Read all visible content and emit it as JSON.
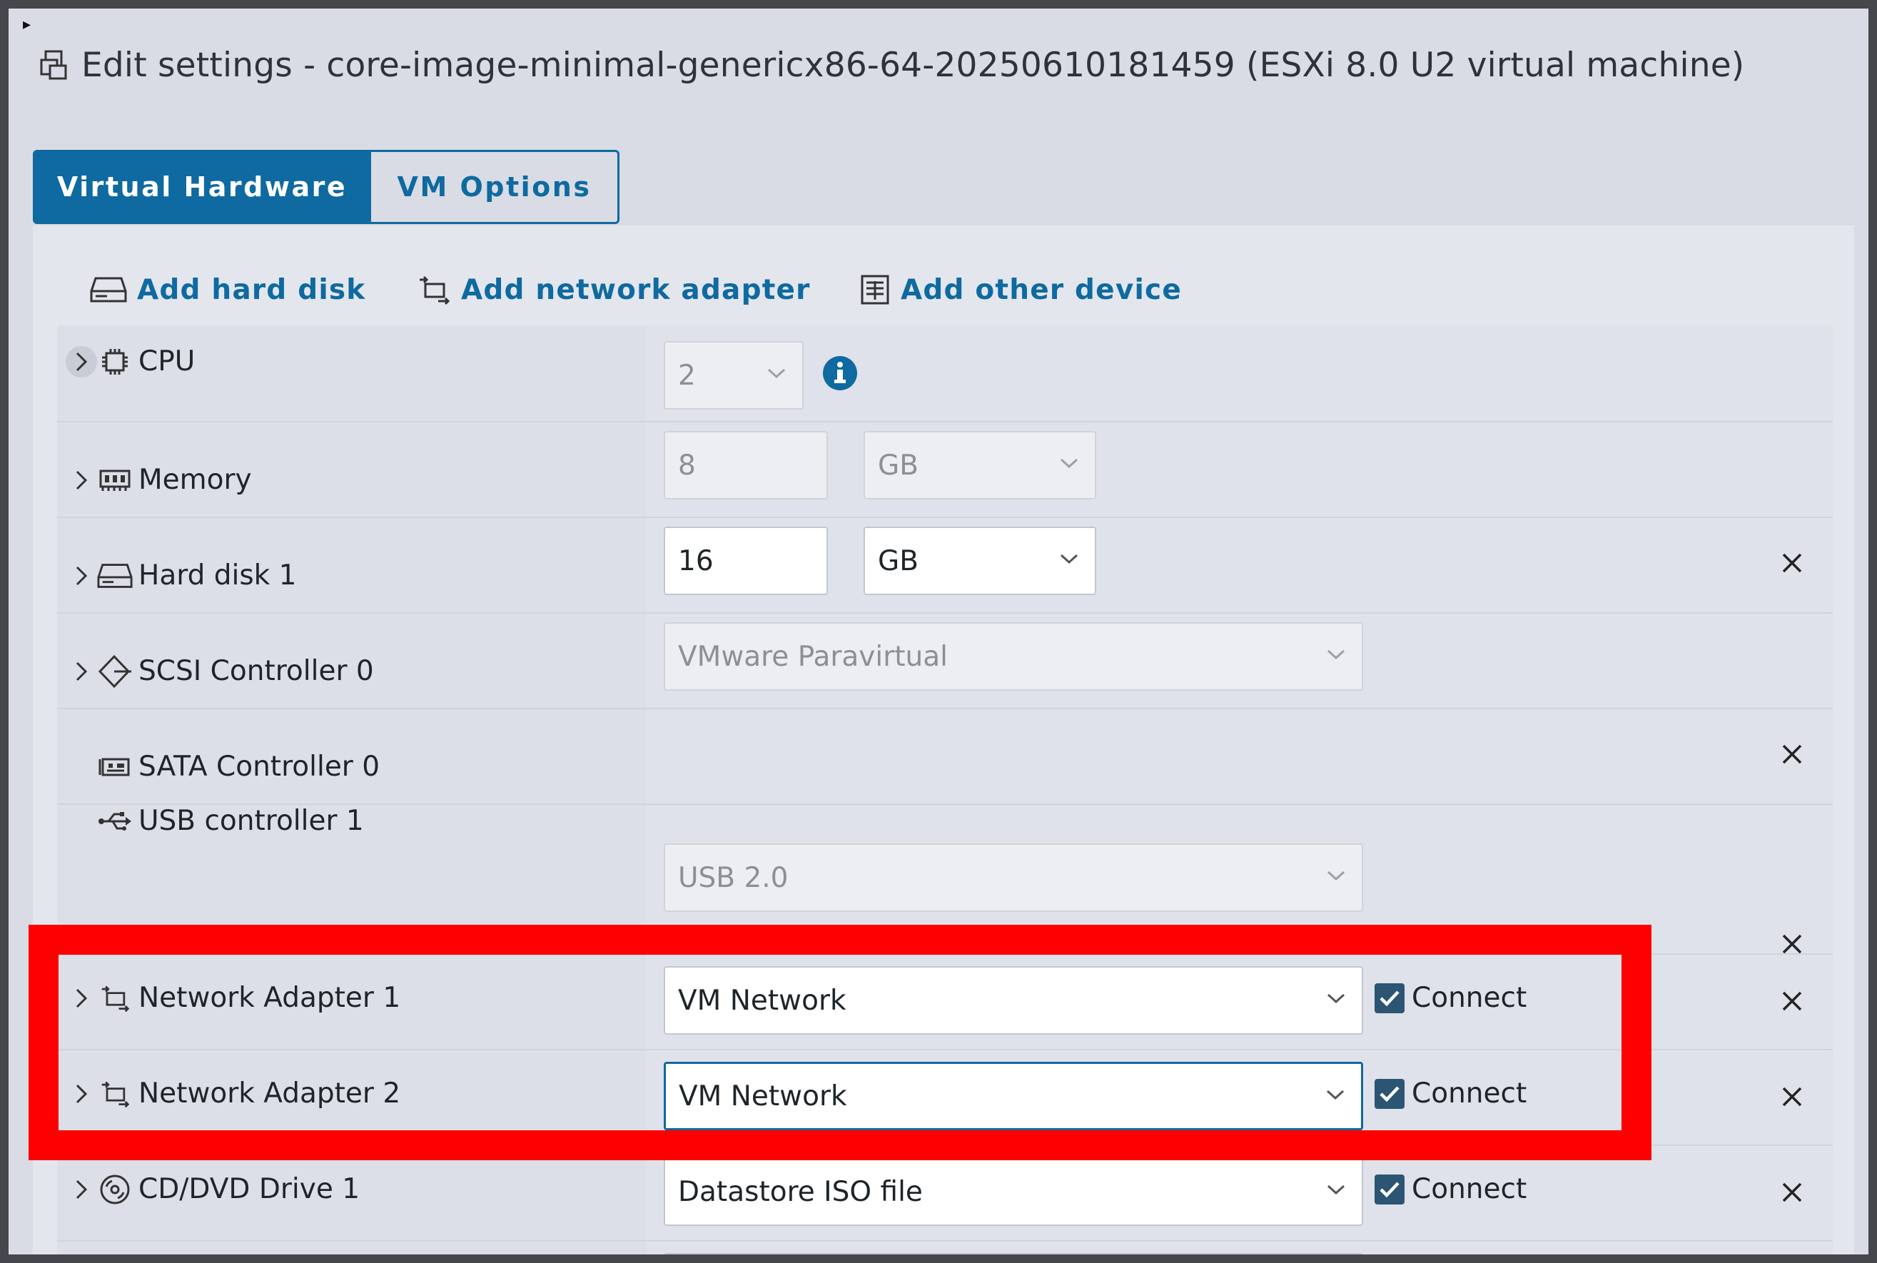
{
  "dialog": {
    "title": "Edit settings - core-image-minimal-genericx86-64-20250610181459 (ESXi 8.0 U2 virtual machine)"
  },
  "tabs": [
    {
      "label": "Virtual Hardware",
      "active": true
    },
    {
      "label": "VM Options",
      "active": false
    }
  ],
  "actions": {
    "add_hard_disk": "Add hard disk",
    "add_network_adapter": "Add network adapter",
    "add_other_device": "Add other device"
  },
  "devices": {
    "cpu": {
      "label": "CPU",
      "value": "2"
    },
    "memory": {
      "label": "Memory",
      "value": "8",
      "unit": "GB"
    },
    "hard_disk_1": {
      "label": "Hard disk 1",
      "value": "16",
      "unit": "GB"
    },
    "scsi_controller_0": {
      "label": "SCSI Controller 0",
      "value": "VMware Paravirtual"
    },
    "sata_controller_0": {
      "label": "SATA Controller 0"
    },
    "usb_controller_1": {
      "label": "USB controller 1",
      "value": "USB 2.0"
    },
    "network_adapter_1": {
      "label": "Network Adapter 1",
      "value": "VM Network",
      "connect_label": "Connect",
      "connected": true
    },
    "network_adapter_2": {
      "label": "Network Adapter 2",
      "value": "VM Network",
      "connect_label": "Connect",
      "connected": true
    },
    "cd_dvd_drive_1": {
      "label": "CD/DVD Drive 1",
      "value": "Datastore ISO file",
      "connect_label": "Connect",
      "connected": true
    }
  },
  "colors": {
    "accent": "#0e6aa0",
    "highlight": "#ff0000",
    "checkbox": "#2b5572"
  }
}
